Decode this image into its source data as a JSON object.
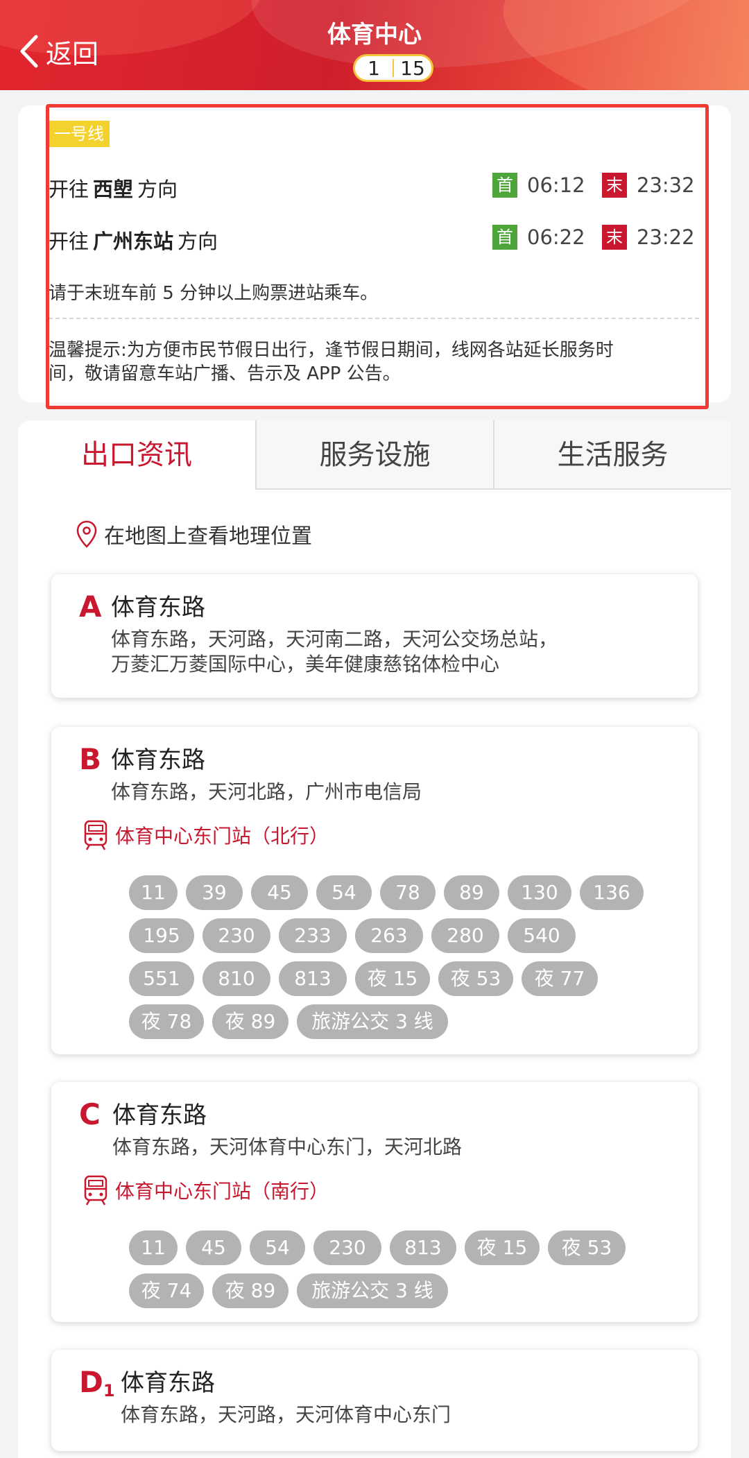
{
  "header": {
    "back_label": "返回",
    "title": "体育中心",
    "page_current": "1",
    "page_total": "15"
  },
  "line_info": {
    "line_name": "一号线",
    "directions": [
      {
        "prefix": "开往",
        "terminal": "西塱",
        "suffix": "方向",
        "first_tag": "首",
        "first_time": "06:12",
        "last_tag": "末",
        "last_time": "23:32"
      },
      {
        "prefix": "开往",
        "terminal": "广州东站",
        "suffix": "方向",
        "first_tag": "首",
        "first_time": "06:22",
        "last_tag": "末",
        "last_time": "23:22"
      }
    ],
    "notice": "请于末班车前 5 分钟以上购票进站乘车。",
    "tip_line1": "温馨提示:为方便市民节假日出行，逢节假日期间，线网各站延长服务时",
    "tip_line2": "间，敬请留意车站广播、告示及 APP 公告。"
  },
  "tabs": [
    "出口资讯",
    "服务设施",
    "生活服务"
  ],
  "map_link": "在地图上查看地理位置",
  "exits": [
    {
      "letter": "A",
      "sub": "",
      "road": "体育东路",
      "desc_line1": "体育东路，天河路，天河南二路，天河公交场总站，",
      "desc_line2": "万菱汇万菱国际中心，美年健康慈铭体检中心"
    },
    {
      "letter": "B",
      "sub": "",
      "road": "体育东路",
      "desc_line1": "体育东路，天河北路，广州市电信局",
      "station": "体育中心东门站（北行）",
      "buses": [
        "11",
        "39",
        "45",
        "54",
        "78",
        "89",
        "130",
        "136",
        "195",
        "230",
        "233",
        "263",
        "280",
        "540",
        "551",
        "810",
        "813",
        "夜 15",
        "夜 53",
        "夜 77",
        "夜 78",
        "夜 89",
        "旅游公交 3 线"
      ]
    },
    {
      "letter": "C",
      "sub": "",
      "road": "体育东路",
      "desc_line1": "体育东路，天河体育中心东门，天河北路",
      "station": "体育中心东门站（南行）",
      "buses": [
        "11",
        "45",
        "54",
        "230",
        "813",
        "夜 15",
        "夜 53",
        "夜 74",
        "夜 89",
        "旅游公交 3 线"
      ]
    },
    {
      "letter": "D",
      "sub": "1",
      "road": "体育东路",
      "desc_line1": "体育东路，天河路，天河体育中心东门"
    }
  ],
  "colors": {
    "brand_red": "#c8172f",
    "first_green": "#4ea539",
    "line_yellow": "#f4d22e",
    "bus_gray": "#b3b3b3"
  },
  "icons": {
    "back": "chevron-left-icon",
    "map": "map-pin-icon",
    "bus_station": "bus-station-icon"
  }
}
